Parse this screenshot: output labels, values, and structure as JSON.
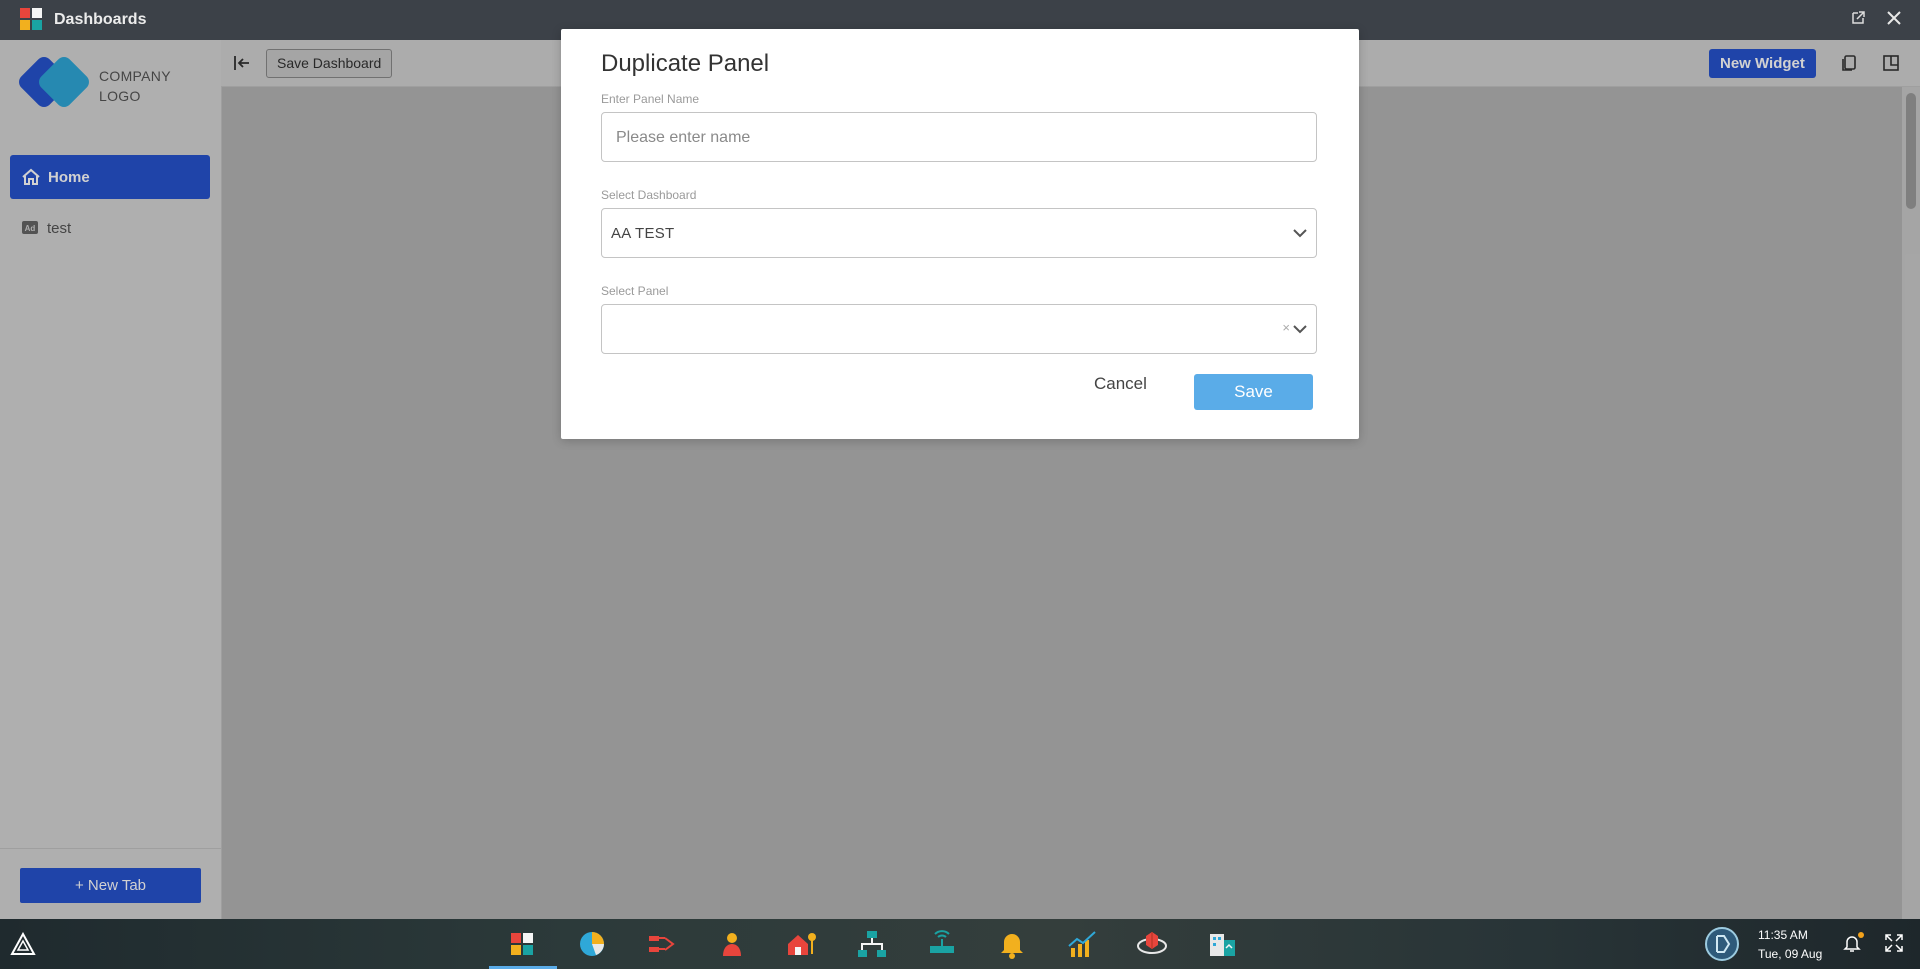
{
  "window": {
    "title": "Dashboards"
  },
  "sidebar": {
    "logo_line1": "COMPANY",
    "logo_line2": "LOGO",
    "items": [
      {
        "label": "Home",
        "icon": "home-icon",
        "active": true
      },
      {
        "label": "test",
        "icon": "ad-icon",
        "active": false
      }
    ],
    "new_tab_label": "+ New Tab"
  },
  "toolbar": {
    "save_dashboard_label": "Save Dashboard",
    "new_widget_label": "New Widget"
  },
  "modal": {
    "title": "Duplicate Panel",
    "panel_name_label": "Enter Panel Name",
    "panel_name_placeholder": "Please enter name",
    "panel_name_value": "",
    "dashboard_label": "Select Dashboard",
    "dashboard_value": "AA TEST",
    "panel_label": "Select Panel",
    "panel_value": "",
    "clear_glyph": "×",
    "cancel_label": "Cancel",
    "save_label": "Save"
  },
  "taskbar": {
    "time": "11:35 AM",
    "date": "Tue, 09 Aug",
    "apps": [
      "dashboards-icon",
      "pie-chart-icon",
      "flow-icon",
      "user-alert-icon",
      "home-key-icon",
      "org-chart-icon",
      "router-icon",
      "bell-alert-icon",
      "trend-chart-icon",
      "globe-box-icon",
      "building-report-icon"
    ]
  },
  "colors": {
    "primary": "#2753cf",
    "save_button": "#5aace8",
    "titlebar": "#3c4148"
  }
}
